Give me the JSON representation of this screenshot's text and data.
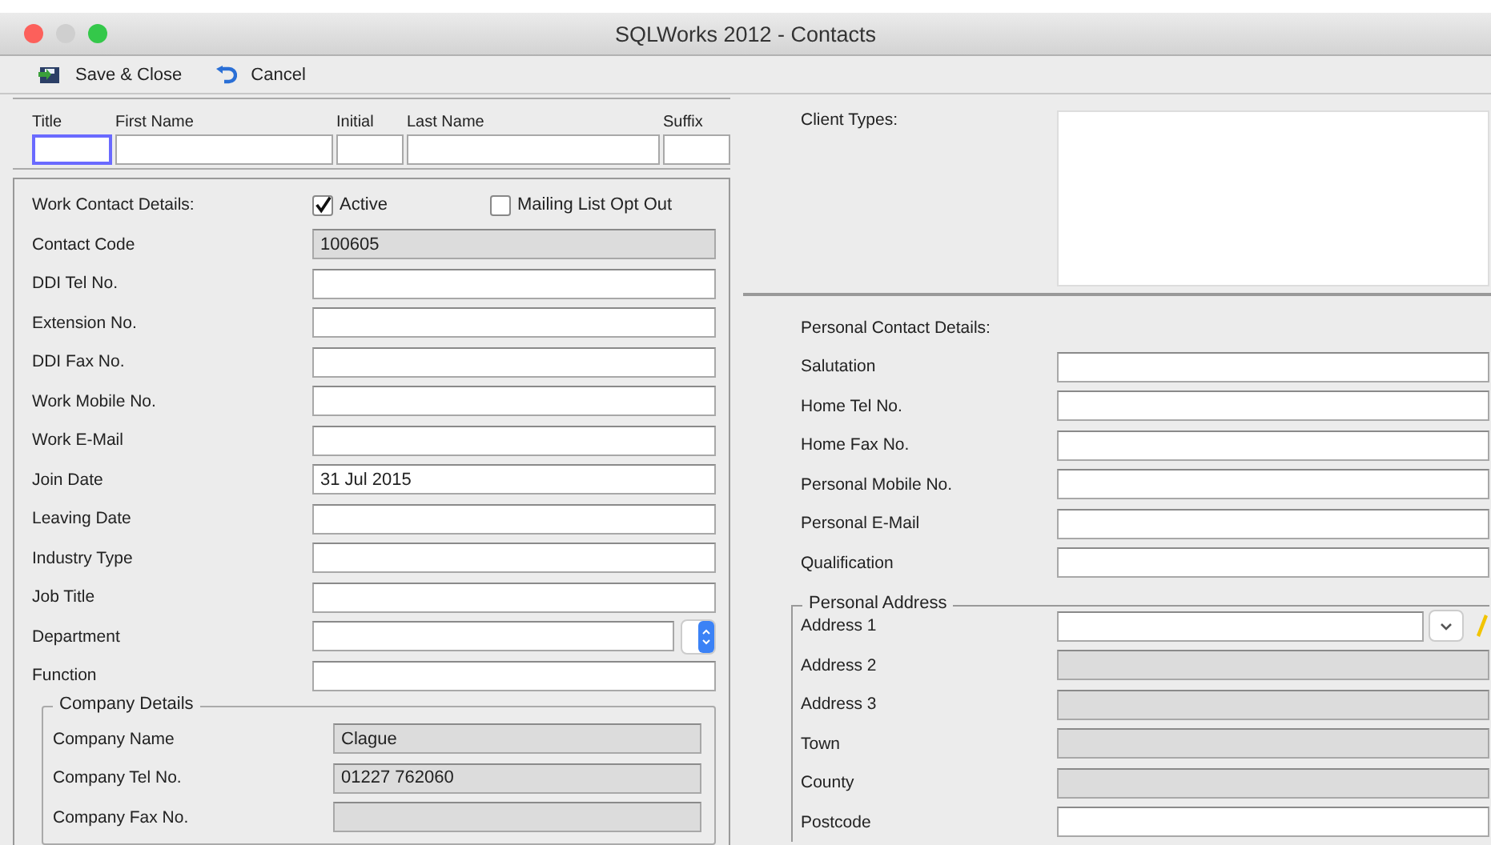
{
  "window": {
    "title": "SQLWorks 2012 - Contacts"
  },
  "toolbar": [
    {
      "kind": "save",
      "label": "Save & Close"
    },
    {
      "kind": "undo",
      "label": "Cancel"
    }
  ],
  "name_fields": [
    {
      "label": "Title",
      "focused": true
    },
    {
      "label": "First Name",
      "focused": false
    },
    {
      "label": "Initial",
      "focused": false
    },
    {
      "label": "Last Name",
      "focused": false
    },
    {
      "label": "Suffix",
      "focused": false
    }
  ],
  "work_contact": {
    "heading": "Work Contact Details:",
    "checkboxes": [
      {
        "label": "Active",
        "checked": true
      },
      {
        "label": "Mailing List Opt Out",
        "checked": false
      }
    ],
    "fields": [
      {
        "label": "Contact Code",
        "value": "100605",
        "disabled": true,
        "kind": "text"
      },
      {
        "label": "DDI Tel No.",
        "disabled": false,
        "kind": "text"
      },
      {
        "label": "Extension No.",
        "disabled": false,
        "kind": "text"
      },
      {
        "label": "DDI Fax No.",
        "disabled": false,
        "kind": "text"
      },
      {
        "label": "Work Mobile No.",
        "disabled": false,
        "kind": "text"
      },
      {
        "label": "Work E-Mail",
        "disabled": false,
        "kind": "text"
      },
      {
        "label": "Join Date",
        "value": "31 Jul 2015",
        "disabled": false,
        "kind": "text"
      },
      {
        "label": "Leaving Date",
        "disabled": false,
        "kind": "text"
      },
      {
        "label": "Industry Type",
        "disabled": false,
        "kind": "text"
      },
      {
        "label": "Job Title",
        "disabled": false,
        "kind": "text"
      },
      {
        "label": "Department",
        "disabled": false,
        "kind": "stepper"
      },
      {
        "label": "Function",
        "disabled": false,
        "kind": "text"
      }
    ]
  },
  "company_details": {
    "legend": "Company Details",
    "fields": [
      {
        "label": "Company Name",
        "value": "Clague",
        "disabled": true,
        "kind": "text"
      },
      {
        "label": "Company Tel No.",
        "value": "01227 762060",
        "disabled": true,
        "kind": "text"
      },
      {
        "label": "Company Fax No.",
        "disabled": true,
        "kind": "text"
      }
    ]
  },
  "client_types": {
    "label": "Client Types:"
  },
  "personal_contact": {
    "heading": "Personal Contact Details:",
    "fields": [
      {
        "label": "Salutation",
        "disabled": false,
        "kind": "text"
      },
      {
        "label": "Home Tel No.",
        "disabled": false,
        "kind": "text"
      },
      {
        "label": "Home Fax No.",
        "disabled": false,
        "kind": "text"
      },
      {
        "label": "Personal Mobile No.",
        "disabled": false,
        "kind": "text"
      },
      {
        "label": "Personal E-Mail",
        "disabled": false,
        "kind": "text"
      },
      {
        "label": "Qualification",
        "disabled": false,
        "kind": "text"
      }
    ]
  },
  "personal_address": {
    "legend": "Personal Address",
    "fields": [
      {
        "label": "Address 1",
        "disabled": false,
        "kind": "combo"
      },
      {
        "label": "Address 2",
        "disabled": true,
        "kind": "text"
      },
      {
        "label": "Address 3",
        "disabled": true,
        "kind": "text"
      },
      {
        "label": "Town",
        "disabled": true,
        "kind": "text"
      },
      {
        "label": "County",
        "disabled": true,
        "kind": "text"
      },
      {
        "label": "Postcode",
        "disabled": false,
        "kind": "text"
      }
    ]
  }
}
